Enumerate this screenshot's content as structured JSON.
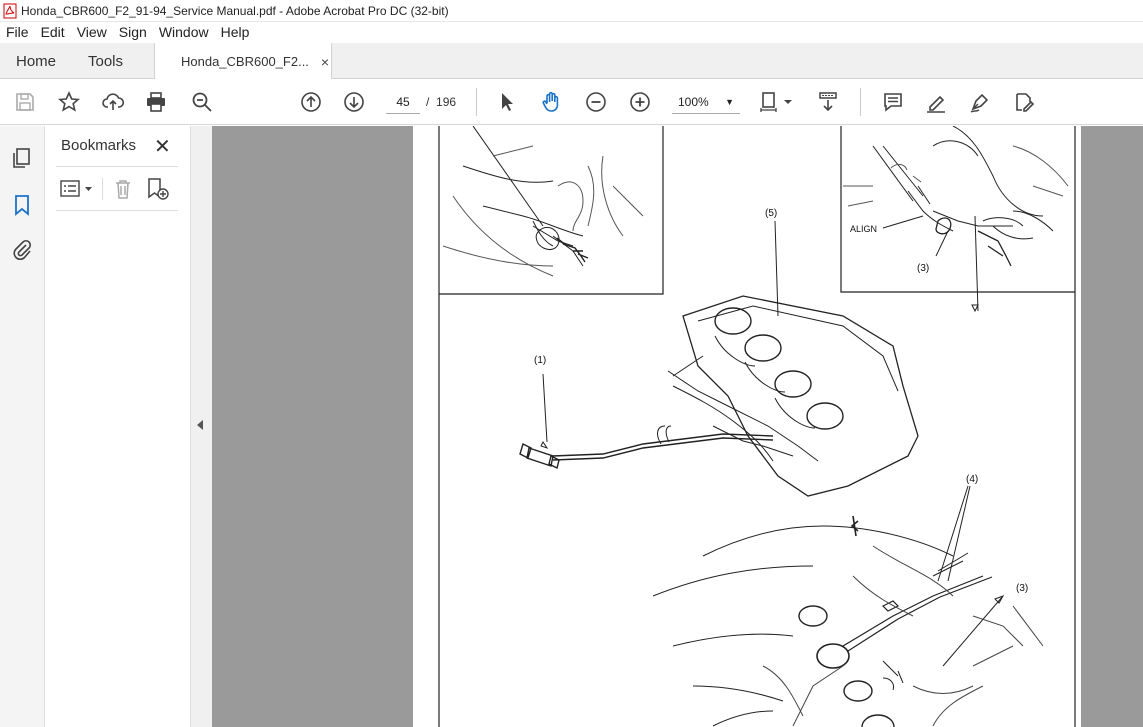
{
  "window": {
    "title": "Honda_CBR600_F2_91-94_Service Manual.pdf - Adobe Acrobat Pro DC (32-bit)"
  },
  "menu": [
    "File",
    "Edit",
    "View",
    "Sign",
    "Window",
    "Help"
  ],
  "tabs": {
    "home": "Home",
    "tools": "Tools",
    "document": "Honda_CBR600_F2...",
    "close": "×"
  },
  "toolbar": {
    "page_current": "45",
    "page_separator": "/",
    "page_total": "196",
    "zoom": "100%"
  },
  "bookmarks": {
    "title": "Bookmarks",
    "close": "✕"
  },
  "figure": {
    "label_1": "(1)",
    "label_3_top": "(3)",
    "label_3_bottom": "(3)",
    "label_4": "(4)",
    "label_5": "(5)",
    "align": "ALIGN"
  }
}
